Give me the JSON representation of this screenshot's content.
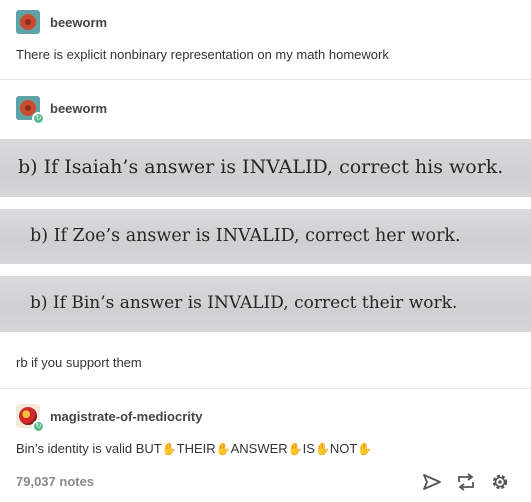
{
  "original_post": {
    "username": "beeworm",
    "text": "There is explicit nonbinary representation on my math homework"
  },
  "reblog_1": {
    "username": "beeworm",
    "photos": [
      "b)  If Isaiah’s answer is INVALID, correct his work.",
      "b)  If Zoe’s answer is INVALID, correct her work.",
      "b)  If Bin’s answer is INVALID, correct their work."
    ],
    "caption": "rb if you support them"
  },
  "reblog_2": {
    "username": "magistrate-of-mediocrity",
    "segments": [
      "Bin’s identity is valid BUT",
      "THEIR",
      "ANSWER",
      "IS",
      "NOT"
    ],
    "emoji_icon": "clapping-hands-icon"
  },
  "footer": {
    "notes": "79,037 notes",
    "icons": [
      "share-icon",
      "reblog-icon",
      "settings-icon"
    ]
  }
}
